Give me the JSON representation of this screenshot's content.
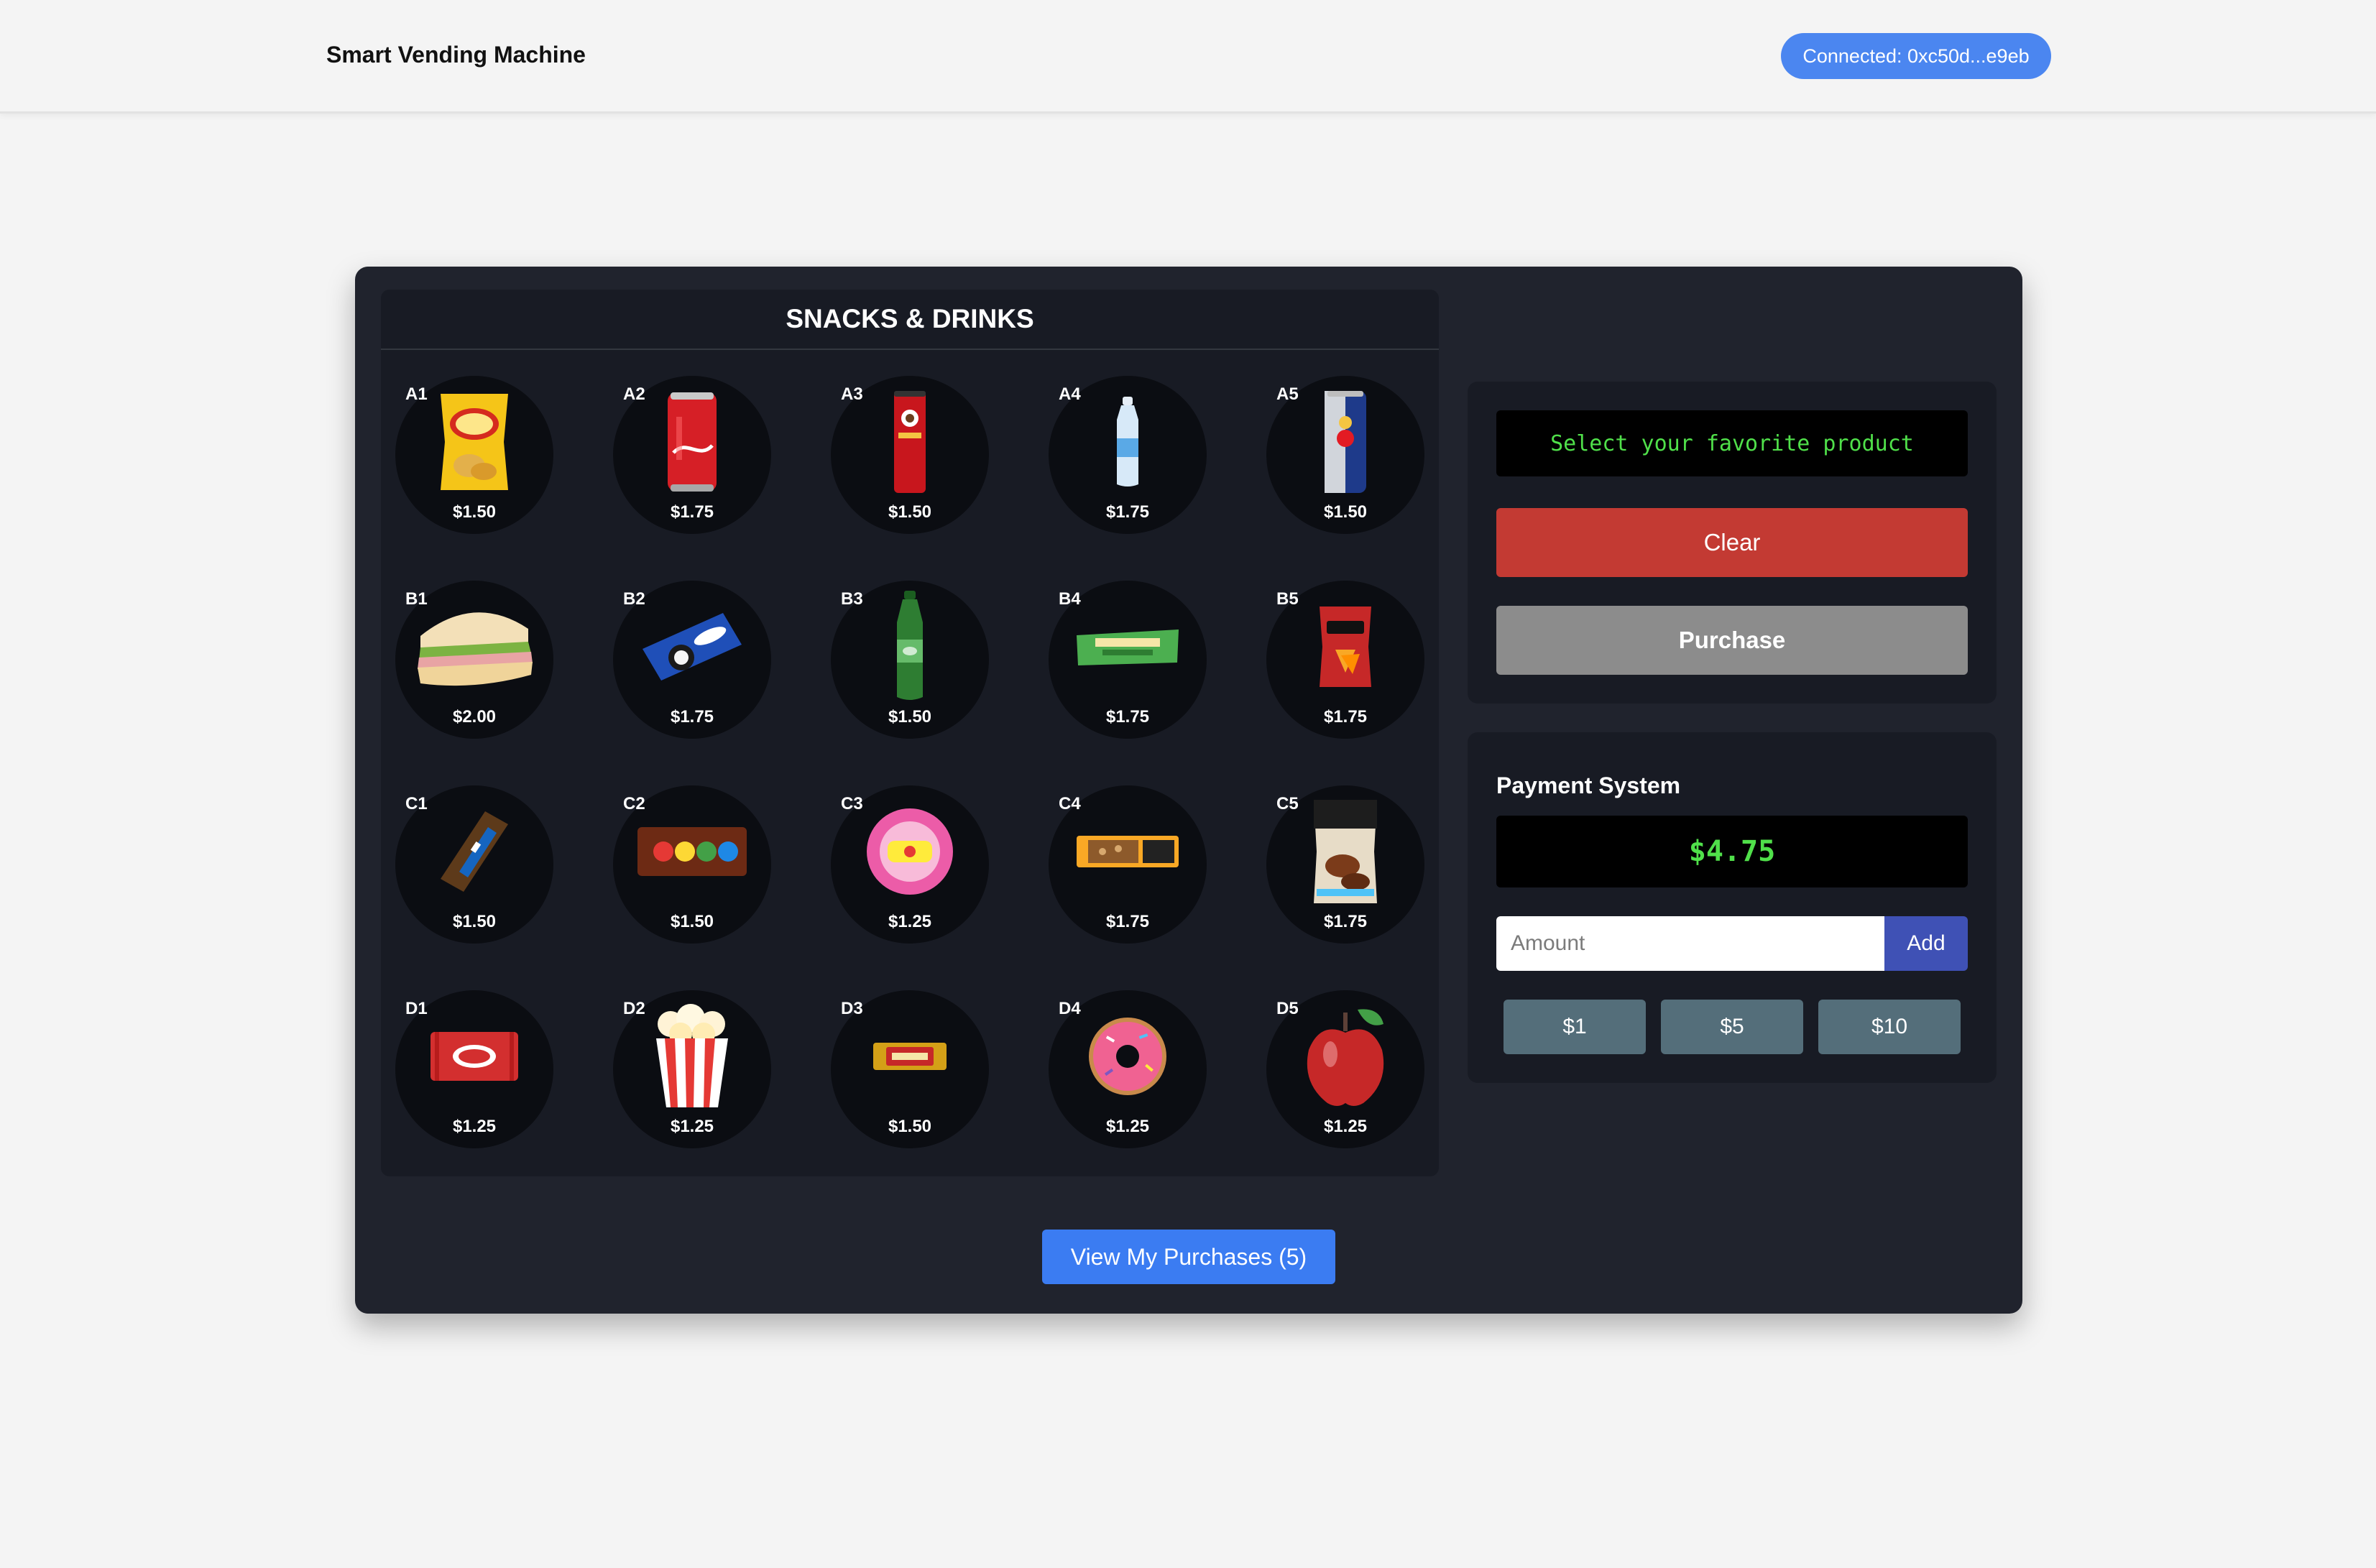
{
  "header": {
    "title": "Smart Vending Machine",
    "wallet_label": "Connected: 0xc50d...e9eb"
  },
  "machine": {
    "shelf_title": "SNACKS & DRINKS",
    "products": [
      {
        "code": "A1",
        "price": "$1.50",
        "icon": "chips-bag-icon"
      },
      {
        "code": "A2",
        "price": "$1.75",
        "icon": "cola-can-icon"
      },
      {
        "code": "A3",
        "price": "$1.50",
        "icon": "chips-tube-icon"
      },
      {
        "code": "A4",
        "price": "$1.75",
        "icon": "water-bottle-icon"
      },
      {
        "code": "A5",
        "price": "$1.50",
        "icon": "energy-drink-can-icon"
      },
      {
        "code": "B1",
        "price": "$2.00",
        "icon": "sandwich-icon"
      },
      {
        "code": "B2",
        "price": "$1.75",
        "icon": "cookie-pack-icon"
      },
      {
        "code": "B3",
        "price": "$1.50",
        "icon": "soda-bottle-icon"
      },
      {
        "code": "B4",
        "price": "$1.75",
        "icon": "granola-bar-icon"
      },
      {
        "code": "B5",
        "price": "$1.75",
        "icon": "tortilla-chips-bag-icon"
      },
      {
        "code": "C1",
        "price": "$1.50",
        "icon": "chocolate-bar-icon"
      },
      {
        "code": "C2",
        "price": "$1.50",
        "icon": "candy-pack-icon"
      },
      {
        "code": "C3",
        "price": "$1.25",
        "icon": "bubble-gum-icon"
      },
      {
        "code": "C4",
        "price": "$1.75",
        "icon": "nut-bar-icon"
      },
      {
        "code": "C5",
        "price": "$1.75",
        "icon": "jerky-bag-icon"
      },
      {
        "code": "D1",
        "price": "$1.25",
        "icon": "wafer-bar-icon"
      },
      {
        "code": "D2",
        "price": "$1.25",
        "icon": "popcorn-icon"
      },
      {
        "code": "D3",
        "price": "$1.50",
        "icon": "caramel-bar-icon"
      },
      {
        "code": "D4",
        "price": "$1.25",
        "icon": "donut-icon"
      },
      {
        "code": "D5",
        "price": "$1.25",
        "icon": "apple-icon"
      }
    ]
  },
  "control": {
    "display_text": "Select your favorite product",
    "clear_label": "Clear",
    "purchase_label": "Purchase"
  },
  "payment": {
    "title": "Payment System",
    "balance": "$4.75",
    "amount_placeholder": "Amount",
    "add_label": "Add",
    "quick_amounts": [
      "$1",
      "$5",
      "$10"
    ]
  },
  "history_button": "View My Purchases (5)",
  "colors": {
    "page_bg": "#f4f4f4",
    "machine_bg": "#20232d",
    "panel_bg": "#181b24",
    "slot_bg": "#0b0d12",
    "display_text": "#50e04a",
    "clear": "#c33a33",
    "purchase_disabled": "#8c8c8c",
    "add": "#3f51b5",
    "quick": "#546e7a",
    "primary": "#3b7cf2"
  }
}
